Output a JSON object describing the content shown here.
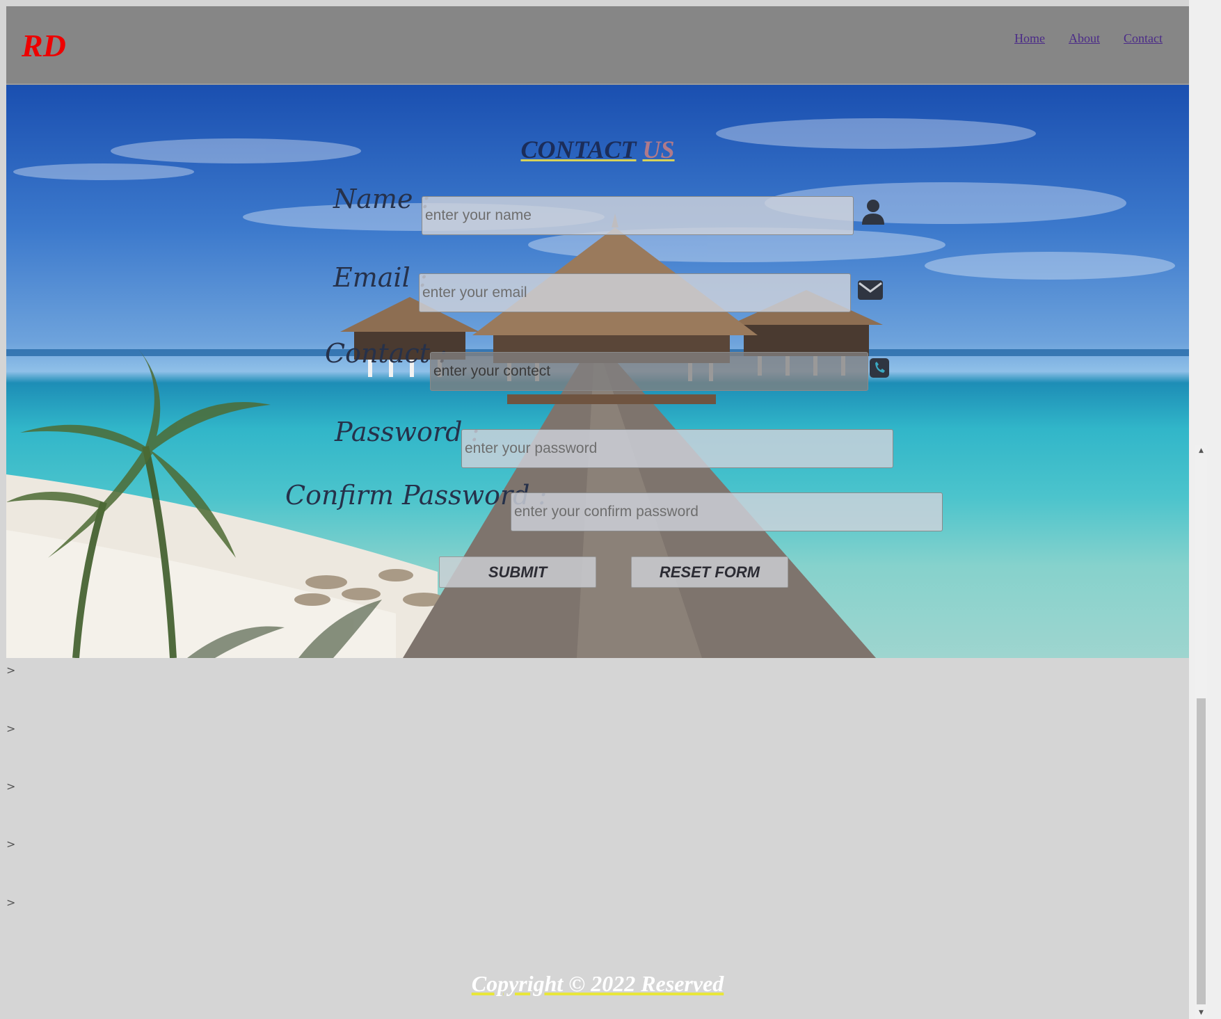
{
  "header": {
    "logo": "RD",
    "nav": [
      {
        "label": "Home"
      },
      {
        "label": "About"
      },
      {
        "label": "Contact"
      }
    ]
  },
  "contact": {
    "title_part1": "CONTACT",
    "title_part2": "US",
    "fields": {
      "name": {
        "label": "Name :",
        "placeholder": "enter your name",
        "icon": "user-icon"
      },
      "email": {
        "label": "Email :",
        "placeholder": "enter your email",
        "icon": "envelope-icon"
      },
      "contact": {
        "label": "Contact :",
        "placeholder": "enter your contect",
        "icon": "phone-icon"
      },
      "password": {
        "label": "Password :",
        "placeholder": "enter your password"
      },
      "confirm_password": {
        "label": "Confirm Password :",
        "placeholder": "enter your confirm password"
      }
    },
    "buttons": {
      "submit": "SUBMIT",
      "reset": "RESET FORM"
    }
  },
  "breaks": [
    ">",
    ">",
    ">",
    ">",
    ">"
  ],
  "footer": {
    "text": "Copyright © 2022 Reserved"
  },
  "colors": {
    "logo": "#ee0000",
    "header_bg": "#868686",
    "page_bg": "#d5d5d5",
    "link": "#4b2b88"
  }
}
